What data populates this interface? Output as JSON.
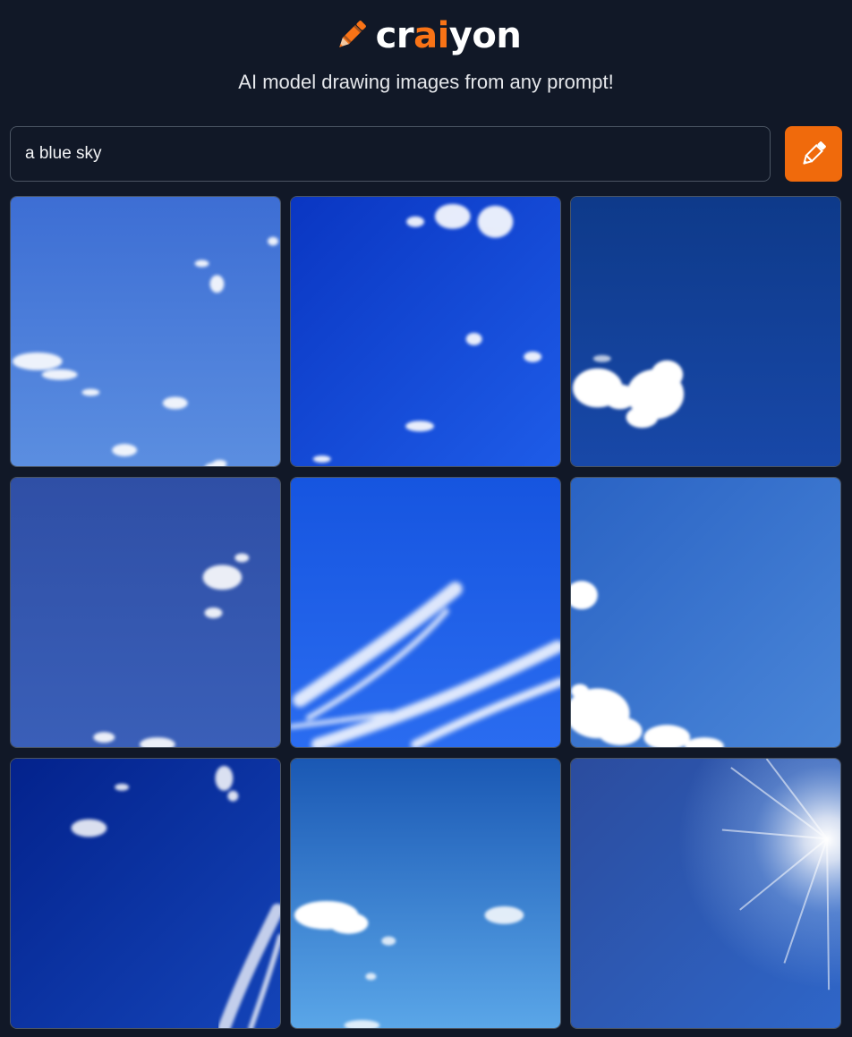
{
  "brand": {
    "name_start": "cr",
    "name_accent": "ai",
    "name_end": "yon",
    "accent_color": "#f97316",
    "logo_icon": "crayon-icon"
  },
  "subtitle": "AI model drawing images from any prompt!",
  "search": {
    "value": "a blue sky",
    "button_icon": "pencil-icon",
    "button_color": "#f06a0c"
  },
  "results": [
    {
      "name": "sky-image-1",
      "description": "light blue sky with scattered small clouds"
    },
    {
      "name": "sky-image-2",
      "description": "deep blue sky with small clouds at top"
    },
    {
      "name": "sky-image-3",
      "description": "dark blue sky with fluffy white cloud"
    },
    {
      "name": "sky-image-4",
      "description": "muted blue sky with small cloud"
    },
    {
      "name": "sky-image-5",
      "description": "bright blue sky with wispy streaks"
    },
    {
      "name": "sky-image-6",
      "description": "light blue sky with clouds at bottom"
    },
    {
      "name": "sky-image-7",
      "description": "deep navy sky with thin clouds"
    },
    {
      "name": "sky-image-8",
      "description": "gradient blue sky with clouds"
    },
    {
      "name": "sky-image-9",
      "description": "blue sky with sun glare on right"
    }
  ]
}
